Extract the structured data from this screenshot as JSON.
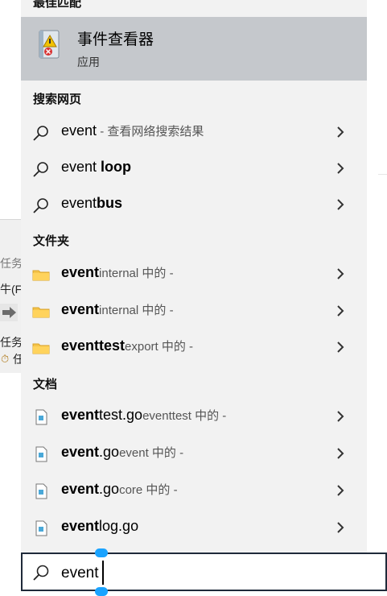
{
  "headers": {
    "best_match": "最佳匹配",
    "search_web": "搜索网页",
    "folders": "文件夹",
    "documents": "文档"
  },
  "best_match": {
    "title": "事件查看器",
    "subtitle": "应用",
    "icon": "event-viewer-icon"
  },
  "web_results": [
    {
      "prefix": "event",
      "bold": "",
      "tail": " - 查看网络搜索结果"
    },
    {
      "prefix": "event ",
      "bold": "loop",
      "tail": ""
    },
    {
      "prefix": "event",
      "bold": "bus",
      "tail": ""
    }
  ],
  "folder_results": [
    {
      "bold": "event",
      "normal": "",
      "tail": "internal 中的 -"
    },
    {
      "bold": "event",
      "normal": "",
      "tail": "internal 中的 -"
    },
    {
      "bold": "eventtest",
      "normal": "",
      "tail": "export 中的 -"
    }
  ],
  "document_results": [
    {
      "bold": "event",
      "normal": "test.go",
      "tail": "eventtest 中的 -"
    },
    {
      "bold": "event",
      "normal": ".go",
      "tail": "event 中的 -"
    },
    {
      "bold": "event",
      "normal": ".go",
      "tail": "core 中的 -"
    },
    {
      "bold": "event",
      "normal": "log.go",
      "tail": ""
    }
  ],
  "search": {
    "value": "event"
  },
  "background_window": {
    "line1": "任务",
    "line2": "牛(F)",
    "line3": "任务",
    "line4": "任"
  },
  "colors": {
    "panel": "#f2f2f2",
    "selected": "#c5c8cc",
    "folder": "#f5c44a",
    "selection_handle": "#1aa3ff"
  }
}
